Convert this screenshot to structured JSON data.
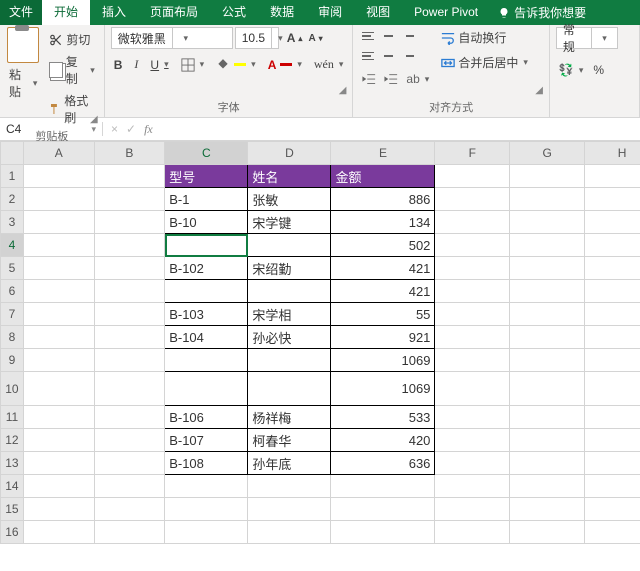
{
  "tabs": {
    "file": "文件",
    "home": "开始",
    "insert": "插入",
    "layout": "页面布局",
    "formulas": "公式",
    "data": "数据",
    "review": "审阅",
    "view": "视图",
    "pivot": "Power Pivot",
    "tell": "告诉我你想要"
  },
  "clipboard": {
    "paste": "粘贴",
    "cut": "剪切",
    "copy": "复制",
    "painter": "格式刷",
    "group": "剪贴板"
  },
  "font": {
    "name": "微软雅黑",
    "size": "10.5",
    "group": "字体"
  },
  "align": {
    "wrap": "自动换行",
    "merge": "合并后居中",
    "group": "对齐方式"
  },
  "number": {
    "fmt": "常规"
  },
  "namebox": "C4",
  "cols": [
    "A",
    "B",
    "C",
    "D",
    "E",
    "F",
    "G",
    "H"
  ],
  "header": {
    "c": "型号",
    "d": "姓名",
    "e": "金额"
  },
  "rows": [
    {
      "c": "B-1",
      "d": "张敏",
      "e": "886"
    },
    {
      "c": "B-10",
      "d": "宋学键",
      "e": "134"
    },
    {
      "c": "",
      "d": "",
      "e": "502"
    },
    {
      "c": "B-102",
      "d": "宋绍勤",
      "e": "421"
    },
    {
      "c": "",
      "d": "",
      "e": "421"
    },
    {
      "c": "B-103",
      "d": "宋学相",
      "e": "55"
    },
    {
      "c": "B-104",
      "d": "孙必快",
      "e": "921"
    },
    {
      "c": "",
      "d": "",
      "e": "1069"
    },
    {
      "c": "",
      "d": "",
      "e": "1069"
    },
    {
      "c": "B-106",
      "d": "杨祥梅",
      "e": "533"
    },
    {
      "c": "B-107",
      "d": "柯春华",
      "e": "420"
    },
    {
      "c": "B-108",
      "d": "孙年底",
      "e": "636"
    }
  ],
  "chart_data": {
    "type": "table",
    "title": "",
    "columns": [
      "型号",
      "姓名",
      "金额"
    ],
    "rows": [
      [
        "B-1",
        "张敏",
        886
      ],
      [
        "B-10",
        "宋学键",
        134
      ],
      [
        "",
        "",
        502
      ],
      [
        "B-102",
        "宋绍勤",
        421
      ],
      [
        "",
        "",
        421
      ],
      [
        "B-103",
        "宋学相",
        55
      ],
      [
        "B-104",
        "孙必快",
        921
      ],
      [
        "",
        "",
        1069
      ],
      [
        "",
        "",
        1069
      ],
      [
        "B-106",
        "杨祥梅",
        533
      ],
      [
        "B-107",
        "柯春华",
        420
      ],
      [
        "B-108",
        "孙年底",
        636
      ]
    ]
  }
}
